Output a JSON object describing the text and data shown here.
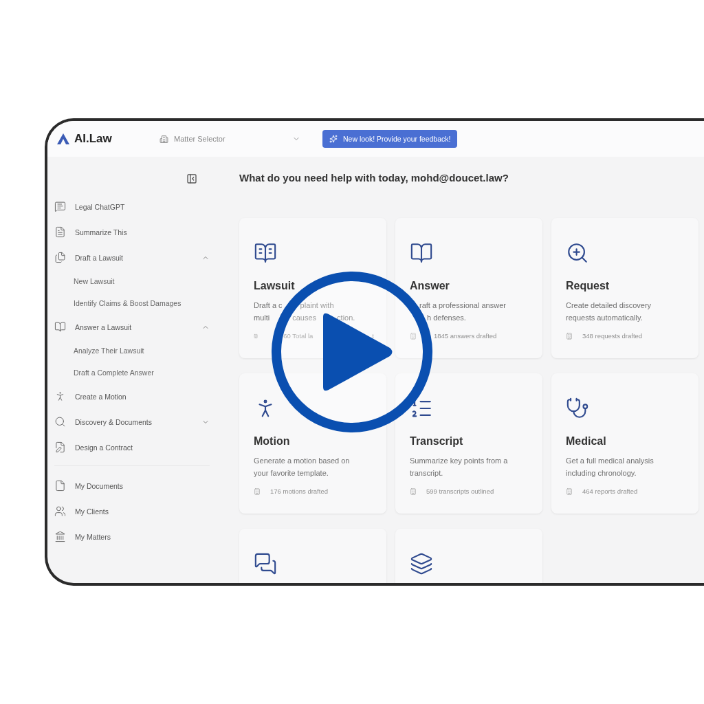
{
  "app": {
    "logo": "AI.Law"
  },
  "matter_selector": {
    "placeholder": "Matter Selector"
  },
  "feedback_button": "New look! Provide your feedback!",
  "greeting": "What do you need help with today, mohd@doucet.law?",
  "sidebar": {
    "sections": [
      {
        "items": [
          {
            "label": "Legal ChatGPT"
          },
          {
            "label": "Summarize This"
          },
          {
            "label": "Draft a Lawsuit",
            "expanded": true,
            "children": [
              {
                "label": "New Lawsuit"
              },
              {
                "label": "Identify Claims & Boost Damages"
              }
            ]
          },
          {
            "label": "Answer a Lawsuit",
            "expanded": true,
            "children": [
              {
                "label": "Analyze Their Lawsuit"
              },
              {
                "label": "Draft a Complete Answer"
              }
            ]
          },
          {
            "label": "Create a Motion"
          },
          {
            "label": "Discovery & Documents",
            "expanded": false
          },
          {
            "label": "Design a Contract"
          }
        ]
      },
      {
        "items": [
          {
            "label": "My Documents"
          },
          {
            "label": "My Clients"
          },
          {
            "label": "My Matters"
          }
        ]
      }
    ]
  },
  "cards": [
    {
      "title": "Lawsuit",
      "description": [
        [
          "Draft a c",
          "plaint with"
        ],
        [
          "multi",
          "causes",
          "ction."
        ]
      ],
      "stat": [
        "60 Total la",
        "t"
      ]
    },
    {
      "title": "Answer",
      "description": [
        [
          "raft a professional answer"
        ],
        [
          "h defenses."
        ]
      ],
      "stat": [
        "1845 answers drafted"
      ]
    },
    {
      "title": "Request",
      "description": [
        [
          "Create detailed discovery"
        ],
        [
          "requests automatically."
        ]
      ],
      "stat": [
        "348 requests drafted"
      ]
    },
    {
      "title": "Motion",
      "description": [
        [
          "Generate a motion based on"
        ],
        [
          "your favorite template."
        ]
      ],
      "stat": [
        "176 motions drafted"
      ]
    },
    {
      "title": "Transcript",
      "description": [
        [
          "Summarize key points from a"
        ],
        [
          "transcript."
        ]
      ],
      "stat": [
        "599 transcripts outlined"
      ]
    },
    {
      "title": "Medical",
      "description": [
        [
          "Get a full medical analysis"
        ],
        [
          "including chronology."
        ]
      ],
      "stat": [
        "464 reports drafted"
      ]
    }
  ]
}
